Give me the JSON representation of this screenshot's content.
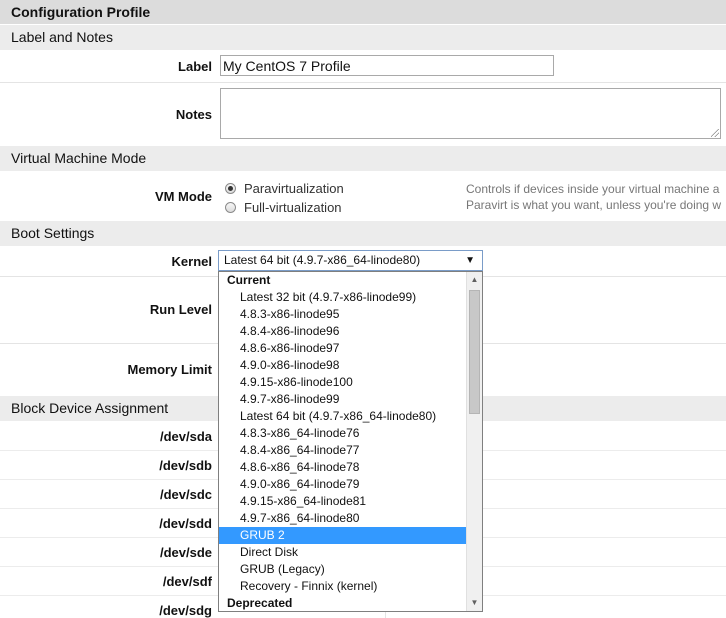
{
  "title": "Configuration Profile",
  "sections": {
    "label_notes": "Label and Notes",
    "vm_mode": "Virtual Machine Mode",
    "boot": "Boot Settings",
    "block": "Block Device Assignment"
  },
  "fields": {
    "label_label": "Label",
    "label_value": "My CentOS 7 Profile",
    "notes_label": "Notes",
    "notes_value": "",
    "vm_mode_label": "VM Mode",
    "vm_options": [
      "Paravirtualization",
      "Full-virtualization"
    ],
    "vm_selected": "Paravirtualization",
    "vm_help_line1": "Controls if devices inside your virtual machine a",
    "vm_help_line2": "Paravirt is what you want, unless you're doing w",
    "kernel_label": "Kernel",
    "kernel_value": "Latest 64 bit (4.9.7-x86_64-linode80)",
    "run_level_label": "Run Level",
    "memory_limit_label": "Memory Limit"
  },
  "kernel_dropdown": {
    "groups": [
      "Current",
      "Deprecated"
    ],
    "items": [
      "Latest 32 bit (4.9.7-x86-linode99)",
      "4.8.3-x86-linode95",
      "4.8.4-x86-linode96",
      "4.8.6-x86-linode97",
      "4.9.0-x86-linode98",
      "4.9.15-x86-linode100",
      "4.9.7-x86-linode99",
      "Latest 64 bit (4.9.7-x86_64-linode80)",
      "4.8.3-x86_64-linode76",
      "4.8.4-x86_64-linode77",
      "4.8.6-x86_64-linode78",
      "4.9.0-x86_64-linode79",
      "4.9.15-x86_64-linode81",
      "4.9.7-x86_64-linode80",
      "GRUB 2",
      "Direct Disk",
      "GRUB (Legacy)",
      "Recovery - Finnix (kernel)"
    ],
    "highlighted": "GRUB 2"
  },
  "block_devices": [
    "/dev/sda",
    "/dev/sdb",
    "/dev/sdc",
    "/dev/sdd",
    "/dev/sde",
    "/dev/sdf",
    "/dev/sdg"
  ],
  "icons": {
    "select_arrow": "▼",
    "scroll_up": "▲",
    "scroll_down": "▼"
  },
  "colors": {
    "highlight": "#3399ff",
    "section_bg": "#ececec",
    "title_bg": "#dcdcdc"
  }
}
